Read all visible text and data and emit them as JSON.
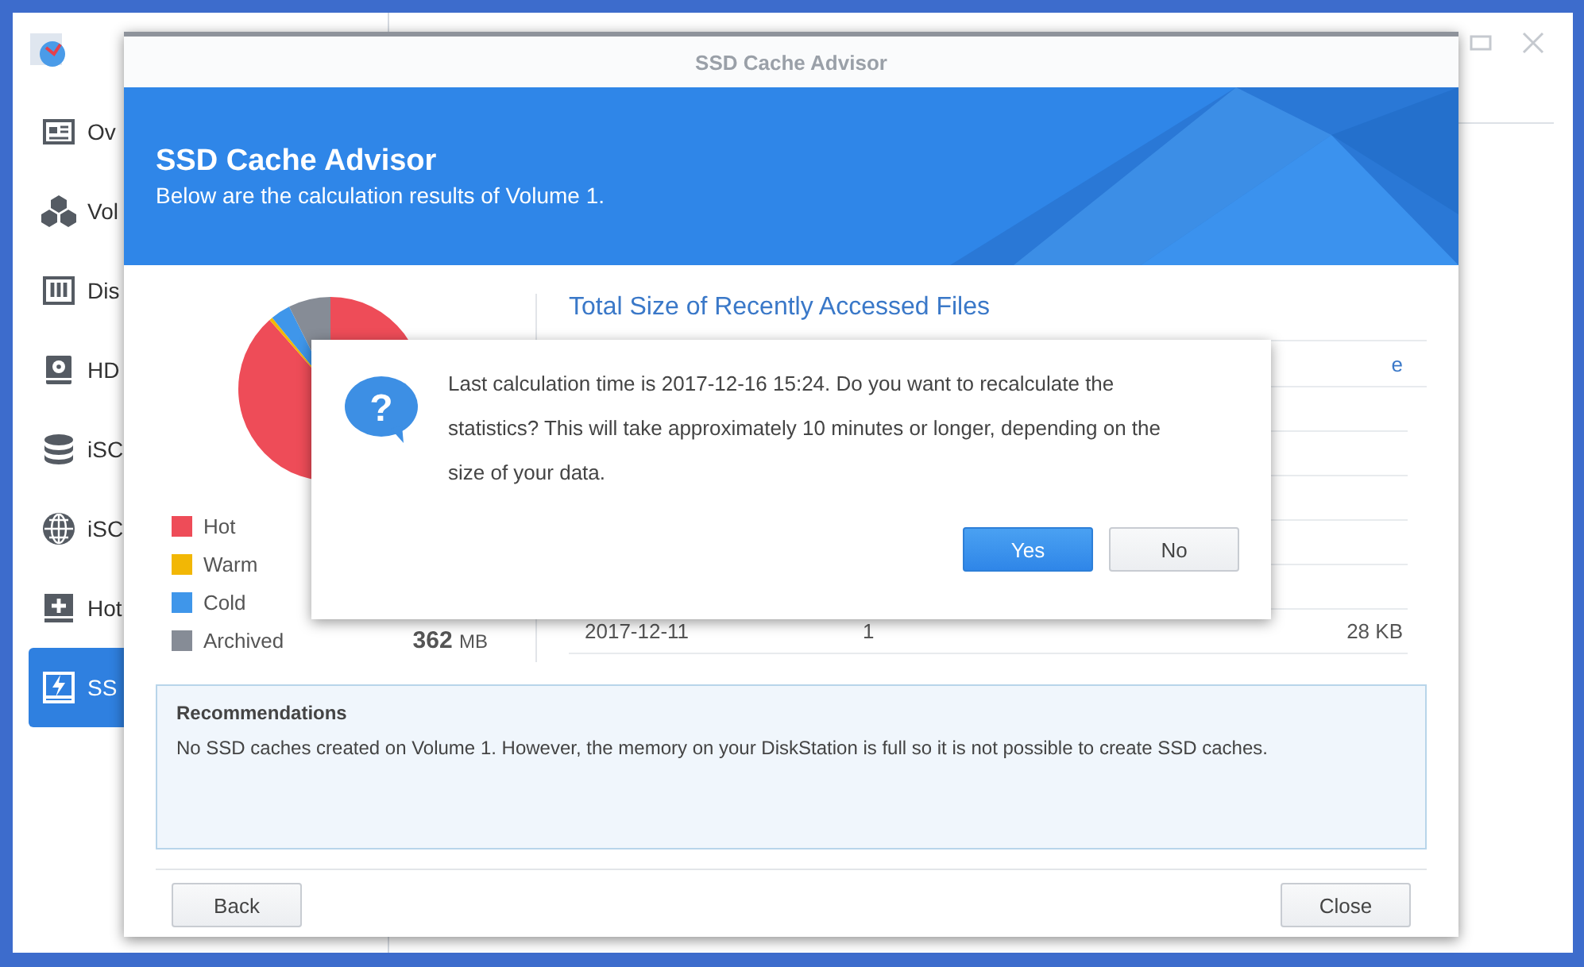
{
  "sidebar": {
    "items": [
      {
        "label": "Ov",
        "kind": "overview",
        "selected": false
      },
      {
        "label": "Vol",
        "kind": "volume",
        "selected": false
      },
      {
        "label": "Dis",
        "kind": "disk",
        "selected": false
      },
      {
        "label": "HD",
        "kind": "hdd",
        "selected": false
      },
      {
        "label": "iSC",
        "kind": "stack",
        "selected": false
      },
      {
        "label": "iSC",
        "kind": "globe",
        "selected": false
      },
      {
        "label": "Hot",
        "kind": "hotspare",
        "selected": false
      },
      {
        "label": "SS",
        "kind": "ssd",
        "selected": true
      }
    ]
  },
  "dialog": {
    "title": "SSD Cache Advisor",
    "banner": {
      "heading": "SSD Cache Advisor",
      "subtitle": "Below are the calculation results of Volume 1."
    },
    "legend": [
      {
        "label": "Hot",
        "color": "#ee4c58"
      },
      {
        "label": "Warm",
        "color": "#f2b705"
      },
      {
        "label": "Cold",
        "color": "#3f96ea"
      },
      {
        "label": "Archived",
        "color": "#868c96",
        "value": "362",
        "unit": "MB"
      }
    ],
    "table": {
      "title": "Total Size of Recently Accessed Files",
      "columns": [
        {},
        {},
        {
          "label": "e"
        }
      ],
      "rows": [
        {
          "cells": [
            "2017-12-11",
            "1",
            "28 KB"
          ]
        }
      ]
    },
    "recommendations": {
      "heading": "Recommendations",
      "text": "No SSD caches created on Volume 1. However, the memory on your DiskStation is full so it is not possible to create SSD caches."
    },
    "buttons": [
      {
        "label": "Back"
      },
      {
        "label": "Close"
      }
    ]
  },
  "confirm": {
    "icon": "?",
    "message": "Last calculation time is 2017-12-16 15:24. Do you want to recalculate the statistics? This will take approximately 10 minutes or longer, depending on the size of your data.",
    "buttons": [
      {
        "label": "Yes",
        "primary": true
      },
      {
        "label": "No",
        "primary": false
      }
    ]
  }
}
